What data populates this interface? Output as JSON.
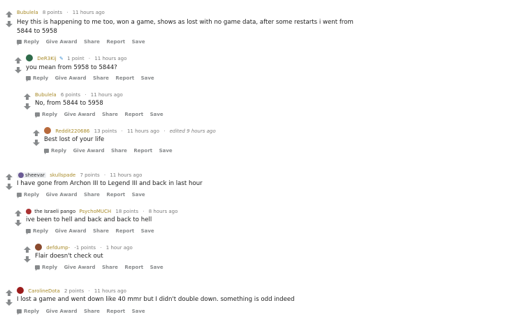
{
  "colors": {
    "author": "#a88a28",
    "meta": "#7c7c7c",
    "action": "#878a8c",
    "arrow": "#878a8c"
  },
  "actions": {
    "reply": "Reply",
    "give_award": "Give Award",
    "share": "Share",
    "report": "Report",
    "save": "Save"
  },
  "comments": [
    {
      "author": "Bubulela",
      "points": "8 points",
      "time": "11 hours ago",
      "text": "Hey this is happening to me too, won a game, shows as lost with no game data, after some restarts i went from 5844 to 5958"
    },
    {
      "author": "DeR3Kij",
      "points": "1 point",
      "time": "11 hours ago",
      "text": "you mean from 5958 to 5844?"
    },
    {
      "author": "Bubulela",
      "points": "6 points",
      "time": "11 hours ago",
      "text": "No, from 5844 to 5958"
    },
    {
      "author": "Reddit220686",
      "points": "13 points",
      "time": "11 hours ago",
      "edited": "edited 9 hours ago",
      "text": "Best lost of your life"
    },
    {
      "flair": "sheevar",
      "author": "skullspade",
      "points": "7 points",
      "time": "11 hours ago",
      "text": "I have gone from Archon III to Legend III and back in last hour"
    },
    {
      "flair_text": "the Israeli pango",
      "author": "PsychoMUCH",
      "points": "18 points",
      "time": "8 hours ago",
      "text": "ive been to hell and back and back to hell"
    },
    {
      "author": "defdump-",
      "points": "-1 points",
      "time": "1 hour ago",
      "text": "Flair doesn't check out"
    },
    {
      "author": "CarolineDota",
      "points": "2 points",
      "time": "11 hours ago",
      "text": "I lost a game and went down like 40 mmr but I didn't double down. something is odd indeed"
    }
  ]
}
